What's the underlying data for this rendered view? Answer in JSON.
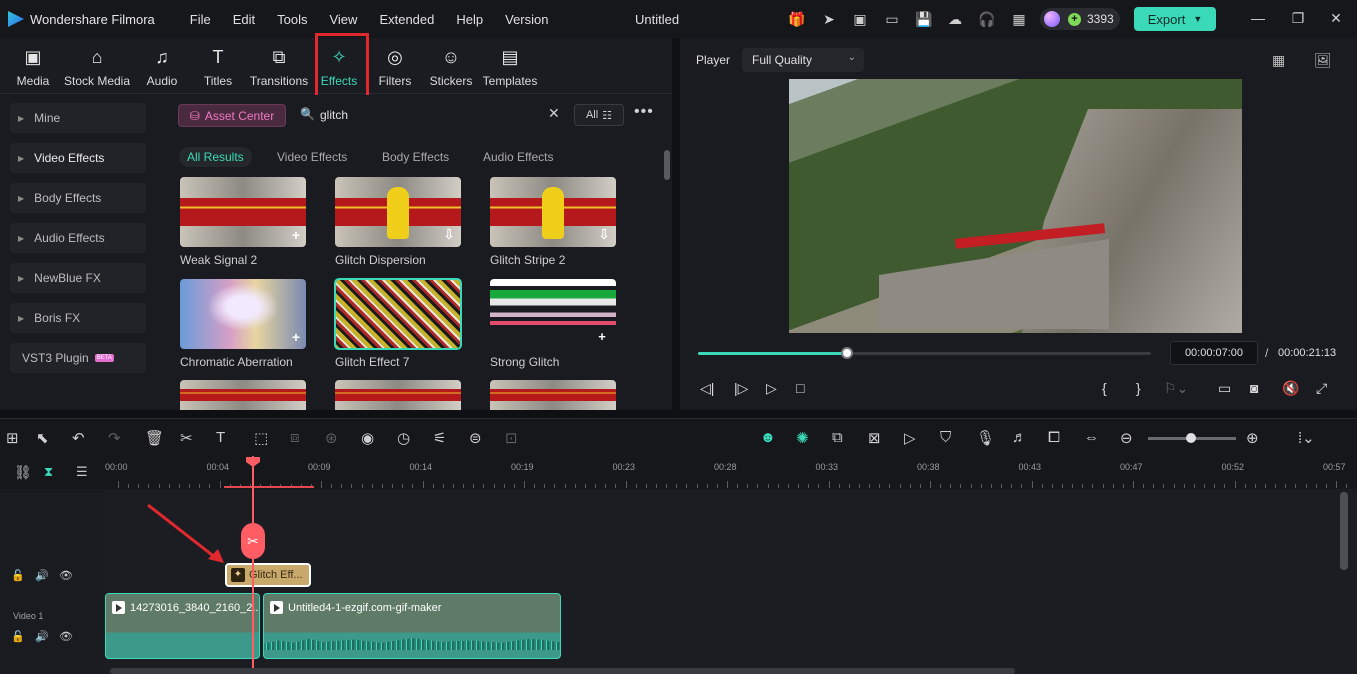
{
  "app": {
    "name": "Wondershare Filmora",
    "menus": [
      "File",
      "Edit",
      "Tools",
      "View",
      "Extended",
      "Help",
      "Version"
    ],
    "document_title": "Untitled",
    "credits": "3393",
    "export_label": "Export"
  },
  "media_tabs": [
    {
      "label": "Media",
      "icon": "media-icon"
    },
    {
      "label": "Stock Media",
      "icon": "stock-media-icon"
    },
    {
      "label": "Audio",
      "icon": "music-note-icon"
    },
    {
      "label": "Titles",
      "icon": "text-icon"
    },
    {
      "label": "Transitions",
      "icon": "transitions-icon"
    },
    {
      "label": "Effects",
      "icon": "effects-icon",
      "active": true
    },
    {
      "label": "Filters",
      "icon": "filters-icon"
    },
    {
      "label": "Stickers",
      "icon": "stickers-icon"
    },
    {
      "label": "Templates",
      "icon": "templates-icon"
    }
  ],
  "sidebar": {
    "items": [
      {
        "label": "Mine"
      },
      {
        "label": "Video Effects",
        "active": true
      },
      {
        "label": "Body Effects"
      },
      {
        "label": "Audio Effects"
      },
      {
        "label": "NewBlue FX"
      },
      {
        "label": "Boris FX"
      },
      {
        "label": "VST3 Plugin",
        "badge": "BETA"
      }
    ]
  },
  "search": {
    "asset_center_label": "Asset Center",
    "query": "glitch",
    "filter_label": "All"
  },
  "result_tabs": [
    "All Results",
    "Video Effects",
    "Body Effects",
    "Audio Effects"
  ],
  "effects": [
    {
      "name": "Weak Signal 2",
      "badge": "+"
    },
    {
      "name": "Glitch Dispersion",
      "badge": "⇩"
    },
    {
      "name": "Glitch Stripe 2",
      "badge": "⇩"
    },
    {
      "name": "Chromatic Aberration",
      "badge": "+"
    },
    {
      "name": "Glitch Effect 7",
      "badge": "",
      "selected": true
    },
    {
      "name": "Strong Glitch",
      "badge": "+"
    }
  ],
  "player": {
    "label": "Player",
    "quality": "Full Quality",
    "current_time": "00:00:07:00",
    "separator": "/",
    "duration": "00:00:21:13",
    "progress_fraction": 0.33
  },
  "timeline": {
    "ruler_ticks": [
      "00:00",
      "00:04",
      "00:09",
      "00:14",
      "00:19",
      "00:23",
      "00:28",
      "00:33",
      "00:38",
      "00:43",
      "00:47",
      "00:52",
      "00:57"
    ],
    "track_name": "Video 1",
    "effect_clip_label": "Glitch Eff...",
    "clips": [
      {
        "title": "14273016_3840_2160_2..."
      },
      {
        "title": "Untitled4-1-ezgif.com-gif-maker"
      }
    ]
  },
  "colors": {
    "accent": "#3ad9b8",
    "playhead": "#ff5c63",
    "highlight_box": "#e0282e",
    "effect_clip": "#c9a86c"
  }
}
